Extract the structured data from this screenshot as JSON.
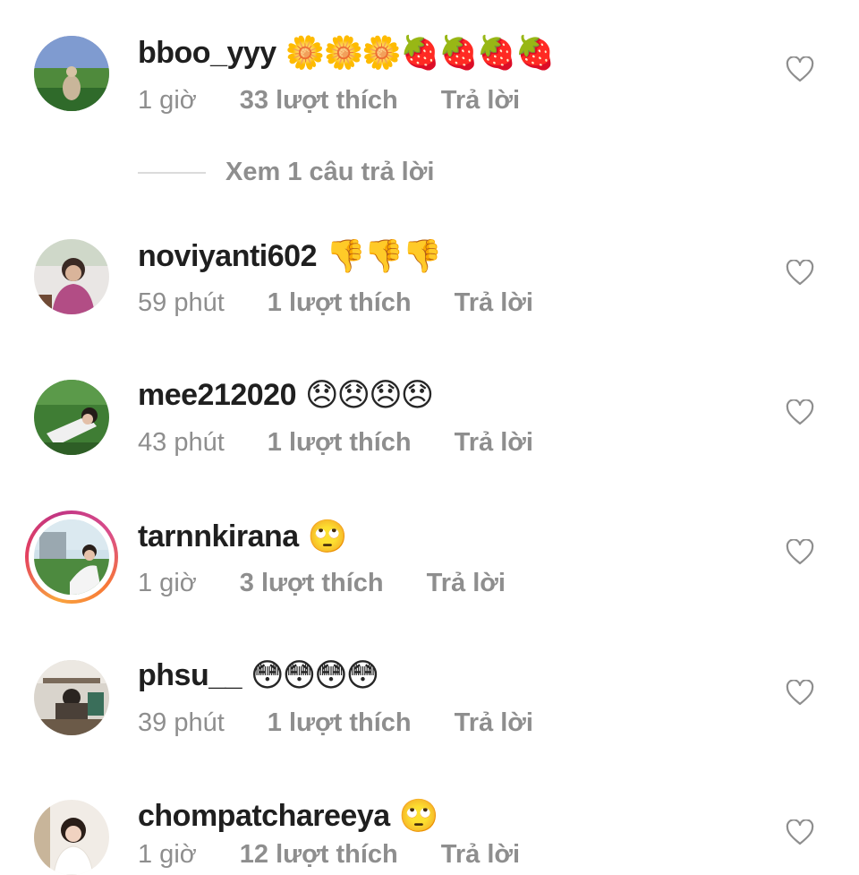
{
  "comments": [
    {
      "username": "bboo_yyy",
      "emoji": "🌼🌼🌼🍓🍓🍓🍓",
      "time": "1 giờ",
      "likes": "33 lượt thích",
      "reply_label": "Trả lời",
      "view_replies": "Xem 1 câu trả lời"
    },
    {
      "username": "noviyanti602",
      "emoji": "👎👎👎",
      "time": "59 phút",
      "likes": "1 lượt thích",
      "reply_label": "Trả lời"
    },
    {
      "username": "mee212020",
      "emoji": "😞😞😞😞",
      "time": "43 phút",
      "likes": "1 lượt thích",
      "reply_label": "Trả lời"
    },
    {
      "username": "tarnnkirana",
      "emoji": "🙄",
      "time": "1 giờ",
      "likes": "3 lượt thích",
      "reply_label": "Trả lời",
      "has_story_ring": true
    },
    {
      "username": "phsu__",
      "emoji": "😳😳😳😳",
      "time": "39 phút",
      "likes": "1 lượt thích",
      "reply_label": "Trả lời"
    },
    {
      "username": "chompatchareeya",
      "emoji": "🙄",
      "time": "1 giờ",
      "likes": "12 lượt thích",
      "reply_label": "Trả lời"
    }
  ],
  "colors": {
    "text_primary": "#262626",
    "text_secondary": "#8e8e8e",
    "divider": "#dbdbdb",
    "story_ring": "#e4405f"
  },
  "icons": {
    "like": "heart-outline-icon"
  }
}
